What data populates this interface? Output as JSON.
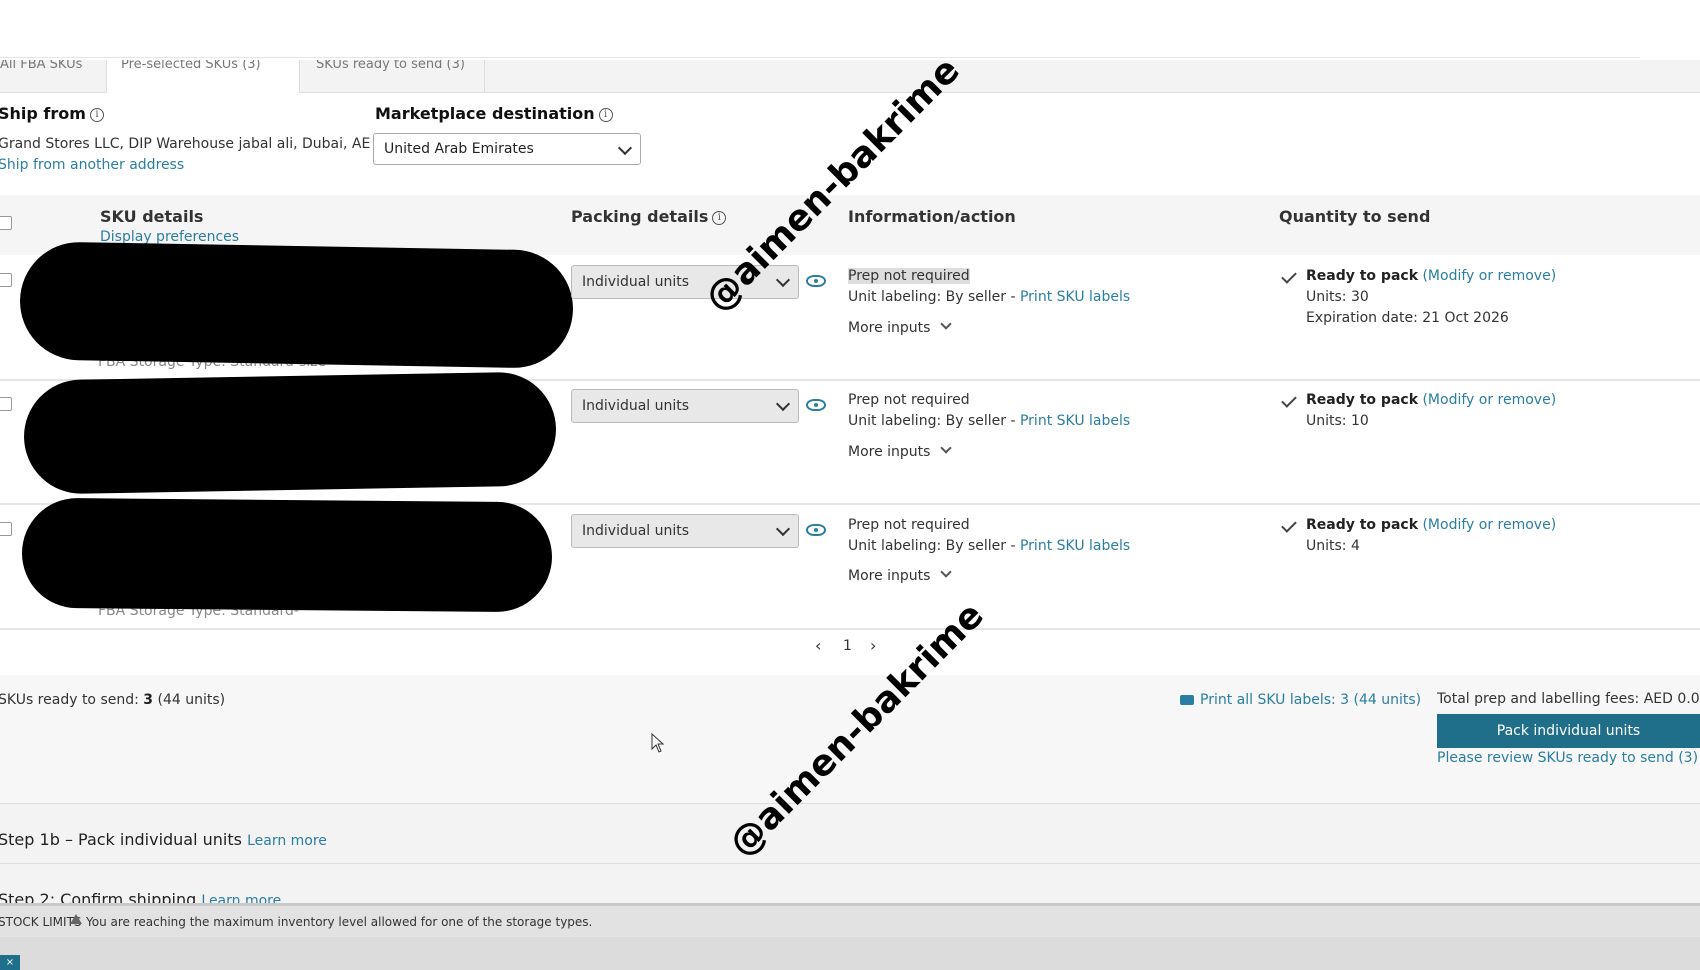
{
  "tabs": [
    {
      "label": "All FBA SKUs"
    },
    {
      "label": "Pre-selected SKUs (3)"
    },
    {
      "label": "SKUs ready to send (3)"
    }
  ],
  "ship_from": {
    "title": "Ship from",
    "address": "Grand Stores LLC, DIP Warehouse jabal ali, Dubai, AE",
    "link": "Ship from another address"
  },
  "marketplace": {
    "title": "Marketplace destination",
    "selected": "United Arab Emirates"
  },
  "columns": {
    "sku": "SKU details",
    "display_prefs": "Display preferences",
    "packing": "Packing details",
    "info": "Information/action",
    "quantity": "Quantity to send"
  },
  "rows": [
    {
      "storage_type": "FBA Storage Type: Standard-size",
      "packing": "Individual units",
      "prep": "Prep not required",
      "labeling_prefix": "Unit labeling: By seller - ",
      "labeling_link": "Print SKU labels",
      "more": "More inputs",
      "status": "Ready to pack",
      "modify": "(Modify or remove)",
      "units": "Units: 30",
      "expiration": "Expiration date: 21 Oct 2026"
    },
    {
      "storage_type": "",
      "packing": "Individual units",
      "prep": "Prep not required",
      "labeling_prefix": "Unit labeling: By seller - ",
      "labeling_link": "Print SKU labels",
      "more": "More inputs",
      "status": "Ready to pack",
      "modify": "(Modify or remove)",
      "units": "Units: 10",
      "expiration": ""
    },
    {
      "storage_type": "FBA Storage Type: Standard-",
      "packing": "Individual units",
      "prep": "Prep not required",
      "labeling_prefix": "Unit labeling: By seller - ",
      "labeling_link": "Print SKU labels",
      "more": "More inputs",
      "status": "Ready to pack",
      "modify": "(Modify or remove)",
      "units": "Units: 4",
      "expiration": ""
    }
  ],
  "pagination": {
    "prev": "‹",
    "page": "1",
    "next": "›"
  },
  "footer": {
    "skus_ready_label": "SKUs ready to send:",
    "skus_ready_value": "3",
    "skus_ready_units": "(44 units)",
    "print_all": "Print all SKU labels: 3 (44 units)",
    "fees_label": "Total prep and labelling fees:",
    "fees_value": "AED 0.0",
    "pack_button": "Pack individual units",
    "review_prefix": "Please review ",
    "review_link": "SKUs ready to send (3)"
  },
  "steps": [
    {
      "title": "Step 1b – Pack individual units",
      "link": "Learn more"
    },
    {
      "title": "Step 2: Confirm shipping",
      "link": "Learn more"
    }
  ],
  "limits": {
    "label": "STOCK LIMITS",
    "message": "You are reaching the maximum inventory level allowed for one of the storage types."
  },
  "close_label": "×",
  "watermark": "@aimen-bakrime",
  "colors": {
    "accent": "#1f6f8b",
    "link": "#2a7ea1"
  }
}
